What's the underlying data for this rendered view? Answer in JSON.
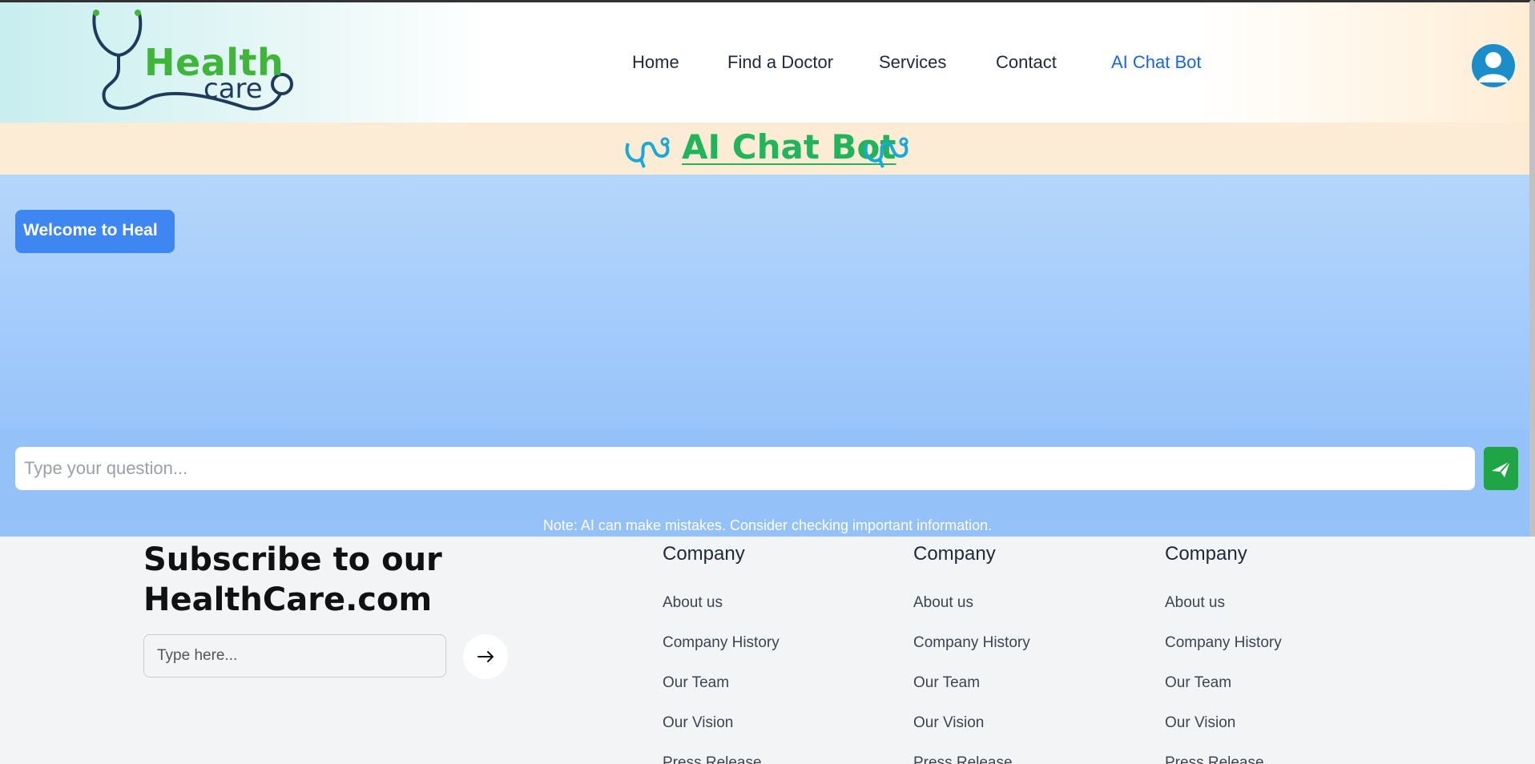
{
  "logo": {
    "word1": "Health",
    "word2": "care"
  },
  "nav": {
    "items": [
      {
        "label": "Home"
      },
      {
        "label": "Find a Doctor"
      },
      {
        "label": "Services"
      },
      {
        "label": "Contact"
      },
      {
        "label": "AI Chat Bot",
        "active": true
      }
    ]
  },
  "page_title": "AI Chat Bot",
  "chat": {
    "messages": [
      {
        "sender": "bot",
        "text": "Welcome to Heal"
      }
    ],
    "input_placeholder": "Type your question...",
    "send_icon": "paper-plane-icon",
    "note": "Note: AI can make mistakes. Consider checking important information."
  },
  "footer": {
    "subscribe_title_line1": "Subscribe to our",
    "subscribe_title_line2": "HealthCare.com",
    "subscribe_placeholder": "Type here...",
    "subscribe_icon": "arrow-right-icon",
    "columns": [
      {
        "title": "Company",
        "links": [
          "About us",
          "Company History",
          "Our Team",
          "Our Vision",
          "Press Release"
        ]
      },
      {
        "title": "Company",
        "links": [
          "About us",
          "Company History",
          "Our Team",
          "Our Vision",
          "Press Release"
        ]
      },
      {
        "title": "Company",
        "links": [
          "About us",
          "Company History",
          "Our Team",
          "Our Vision",
          "Press Release"
        ]
      }
    ]
  },
  "colors": {
    "brand_green": "#3fb53a",
    "nav_active": "#1666e6",
    "title_green": "#22b45a",
    "bubble_blue": "#3e86f1",
    "send_green": "#20a546",
    "avatar_blue": "#1b8ec9"
  }
}
